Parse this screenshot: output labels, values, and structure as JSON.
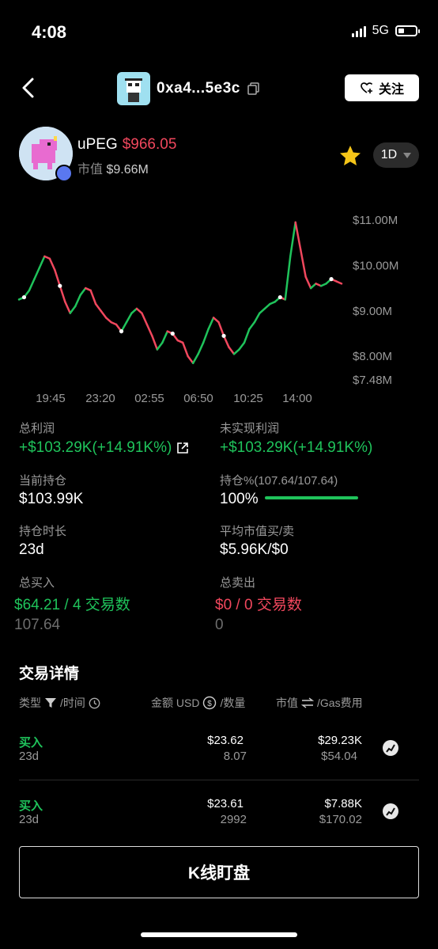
{
  "status_bar": {
    "time": "4:08",
    "network": "5G"
  },
  "header": {
    "address": "0xa4...5e3c",
    "follow_label": "关注"
  },
  "token": {
    "name": "uPEG",
    "price": "$966.05",
    "mcap_label": "市值",
    "mcap_value": "$9.66M",
    "period": "1D"
  },
  "chart_data": {
    "type": "line",
    "y_ticks": [
      "$11.00M",
      "$10.00M",
      "$9.00M",
      "$8.00M",
      "$7.48M"
    ],
    "x_ticks": [
      "19:45",
      "23:20",
      "02:55",
      "06:50",
      "10:25",
      "14:00"
    ],
    "ylim": [
      7.48,
      11.0
    ],
    "values": [
      9.25,
      9.3,
      9.45,
      9.7,
      9.95,
      10.2,
      10.15,
      9.9,
      9.55,
      9.2,
      8.95,
      9.1,
      9.35,
      9.5,
      9.45,
      9.15,
      9.0,
      8.85,
      8.75,
      8.7,
      8.55,
      8.75,
      8.95,
      9.05,
      8.95,
      8.7,
      8.45,
      8.15,
      8.3,
      8.55,
      8.5,
      8.35,
      8.3,
      8.0,
      7.85,
      8.05,
      8.3,
      8.6,
      8.85,
      8.75,
      8.45,
      8.2,
      8.05,
      8.15,
      8.3,
      8.6,
      8.75,
      8.95,
      9.05,
      9.15,
      9.2,
      9.3,
      9.25,
      10.2,
      10.95,
      10.35,
      9.75,
      9.5,
      9.6,
      9.55,
      9.6,
      9.7,
      9.65,
      9.6
    ],
    "colors": {
      "up": "#1fc35b",
      "down": "#f0475d"
    }
  },
  "stats": {
    "total_profit_label": "总利润",
    "total_profit_value": "+$103.29K(+14.91K%)",
    "unrealized_label": "未实现利润",
    "unrealized_value": "+$103.29K(+14.91K%)",
    "holding_label": "当前持仓",
    "holding_value": "$103.99K",
    "holding_pct_label": "持仓%(107.64/107.64)",
    "holding_pct_value": "100%",
    "holding_pct": 1.0,
    "duration_label": "持仓时长",
    "duration_value": "23d",
    "avg_label": "平均市值买/卖",
    "avg_value": "$5.96K/$0",
    "buy_label": "总买入",
    "buy_value": "$64.21 / 4 交易数",
    "buy_amount": "107.64",
    "sell_label": "总卖出",
    "sell_value": "$0 / 0 交易数",
    "sell_amount": "0"
  },
  "trades": {
    "title": "交易详情",
    "col_type": "类型",
    "col_time": "/时间",
    "col_amount": "金额 USD",
    "col_qty": "/数量",
    "col_mcap": "市值",
    "col_gas": "/Gas费用",
    "rows": [
      {
        "type": "买入",
        "time": "23d",
        "amount": "$23.62",
        "qty": "8.07",
        "mcap": "$29.23K",
        "gas": "$54.04"
      },
      {
        "type": "买入",
        "time": "23d",
        "amount": "$23.61",
        "qty": "2992",
        "mcap": "$7.88K",
        "gas": "$170.02"
      }
    ]
  },
  "bottom": {
    "kline_label": "K线盯盘"
  }
}
